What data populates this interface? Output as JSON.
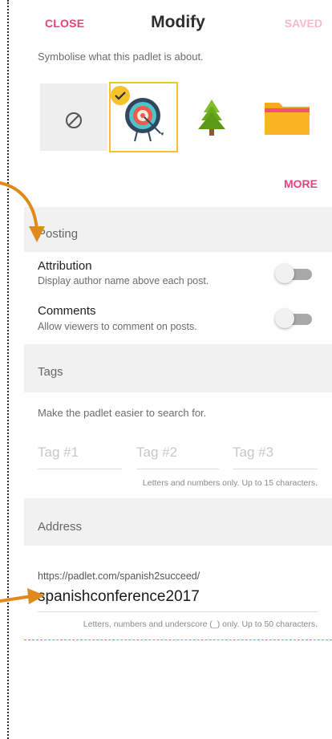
{
  "header": {
    "close_label": "CLOSE",
    "title": "Modify",
    "saved_label": "SAVED"
  },
  "icon_section": {
    "description": "Symbolise what this padlet is about.",
    "icons": [
      {
        "name": "none-icon",
        "selected": false
      },
      {
        "name": "target-icon",
        "selected": true
      },
      {
        "name": "tree-icon",
        "selected": false
      },
      {
        "name": "folder-icon",
        "selected": false
      }
    ],
    "more_label": "MORE"
  },
  "posting": {
    "heading": "Posting",
    "attribution": {
      "title": "Attribution",
      "subtitle": "Display author name above each post.",
      "on": false
    },
    "comments": {
      "title": "Comments",
      "subtitle": "Allow viewers to comment on posts.",
      "on": false
    }
  },
  "tags": {
    "heading": "Tags",
    "description": "Make the padlet easier to search for.",
    "fields": [
      {
        "placeholder": "Tag #1",
        "value": ""
      },
      {
        "placeholder": "Tag #2",
        "value": ""
      },
      {
        "placeholder": "Tag #3",
        "value": ""
      }
    ],
    "hint": "Letters and numbers only. Up to 15 characters."
  },
  "address": {
    "heading": "Address",
    "prefix": "https://padlet.com/spanish2succeed/",
    "value": "spanishconference2017",
    "hint": "Letters, numbers and underscore (_) only. Up to 50 characters."
  },
  "colors": {
    "accent": "#ec3f7c",
    "selection": "#f5c22b",
    "annotation_arrow": "#e08a1e"
  }
}
